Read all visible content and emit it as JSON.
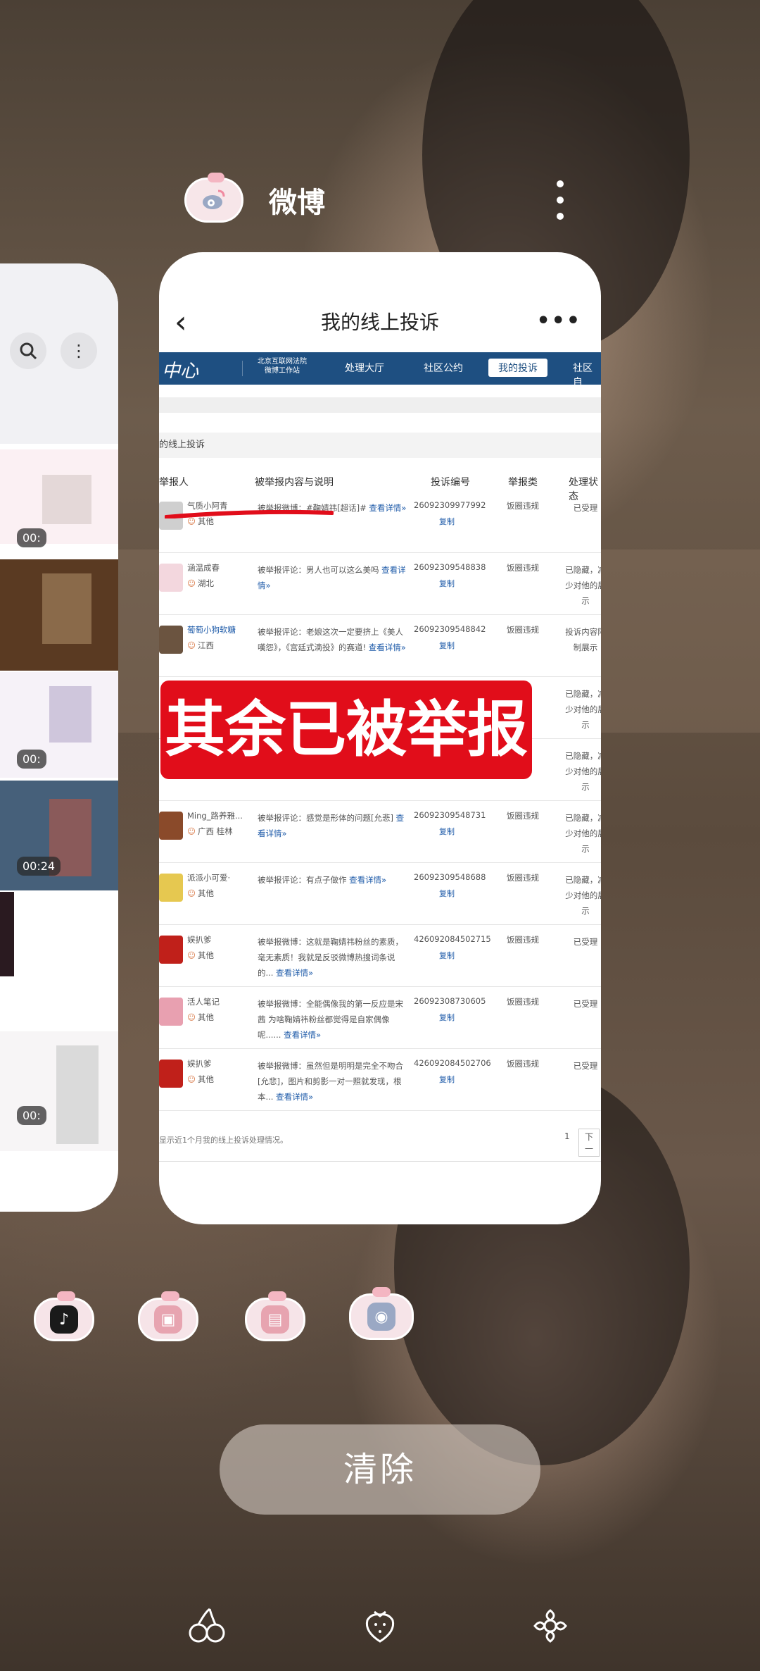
{
  "app_header": {
    "app_name": "微博",
    "more_icon": "vertical-dots-icon"
  },
  "left_card": {
    "time_tags": [
      "00:",
      "00:",
      "00:24",
      "00:"
    ]
  },
  "main_card": {
    "title": "我的线上投诉",
    "nav": {
      "logo": "中心",
      "items": [
        "北京互联网法院\n微博工作站",
        "处理大厅",
        "社区公约",
        "我的投诉",
        "社区自"
      ],
      "active": "我的投诉"
    },
    "section_title": "的线上投诉",
    "table_headers": [
      "举报人",
      "被举报内容与说明",
      "投诉编号",
      "举报类",
      "处理状态"
    ],
    "rows": [
      {
        "name": "气质小阿青",
        "loc": "其他",
        "desc": "被举报微博：#鞠婧祎[超话]#",
        "link": "查看详情»",
        "num": "26092309977992",
        "cat": "饭圈违规",
        "status": "已受理"
      },
      {
        "name": "涵温成春",
        "loc": "湖北",
        "desc": "被举报评论：男人也可以这么美吗",
        "link": "查看详情»",
        "num": "26092309548838",
        "cat": "饭圈违规",
        "status": "已隐藏，减少对他的展示"
      },
      {
        "name": "葡萄小狗软糖",
        "loc": "江西",
        "desc": "被举报评论：老娘这次一定要挤上《美人嘆怨》，《宫廷式滴投》的赛道!",
        "link": "查看详情»",
        "num": "26092309548842",
        "cat": "饭圈违规",
        "status": "投诉内容限制展示"
      },
      {
        "name": "",
        "loc": "",
        "desc": "",
        "link": "",
        "num": "",
        "cat": "",
        "status": "已隐藏，减少对他的展示"
      },
      {
        "name": "",
        "loc": "",
        "desc": "",
        "link": "",
        "num": "",
        "cat": "",
        "status": "已隐藏，减少对他的展示"
      },
      {
        "name": "Ming_路养雅...",
        "loc": "广西 桂林",
        "desc": "被举报评论：感觉是形体的问题[允悲]",
        "link": "查看详情»",
        "num": "26092309548731",
        "cat": "饭圈违规",
        "status": "已隐藏，减少对他的展示"
      },
      {
        "name": "派派小可爱·",
        "loc": "其他",
        "desc": "被举报评论：有点子做作",
        "link": "查看详情»",
        "num": "26092309548688",
        "cat": "饭圈违规",
        "status": "已隐藏，减少对他的展示"
      },
      {
        "name": "娱扒爹",
        "loc": "其他",
        "desc": "被举报微博：这就是鞠婧祎粉丝的素质，毫无素质！我就是反驳微博热搜词条说的...",
        "link": "查看详情»",
        "num": "426092084502715",
        "cat": "饭圈违规",
        "status": "已受理"
      },
      {
        "name": "活人笔记",
        "loc": "其他",
        "desc": "被举报微博：全能偶像我的第一反应是宋茜 为啥鞠婧祎粉丝都觉得是自家偶像呢......",
        "link": "查看详情»",
        "num": "26092308730605",
        "cat": "饭圈违规",
        "status": "已受理"
      },
      {
        "name": "娱扒爹",
        "loc": "其他",
        "desc": "被举报微博：虽然但是明明是完全不吻合[允悲]，图片和剪影一对一照就发现，根本...",
        "link": "查看详情»",
        "num": "426092084502706",
        "cat": "饭圈违规",
        "status": "已受理"
      }
    ],
    "copy_label": "复制",
    "overlay_text": "其余已被举报",
    "footer_note": "显示近1个月我的线上投诉处理情况。",
    "pager": {
      "page": "1",
      "next": "下一"
    }
  },
  "dock": [
    {
      "name": "douyin-app-icon",
      "color": "#1a1a1a"
    },
    {
      "name": "gallery-app-icon",
      "color": "#e7a4b0"
    },
    {
      "name": "photos-app-icon",
      "color": "#e7a4b0"
    },
    {
      "name": "weibo-app-icon",
      "color": "#9aa8c4"
    }
  ],
  "clear_label": "清除",
  "bottom_nav_icons": [
    "cherry-icon",
    "strawberry-icon",
    "flower-icon"
  ]
}
